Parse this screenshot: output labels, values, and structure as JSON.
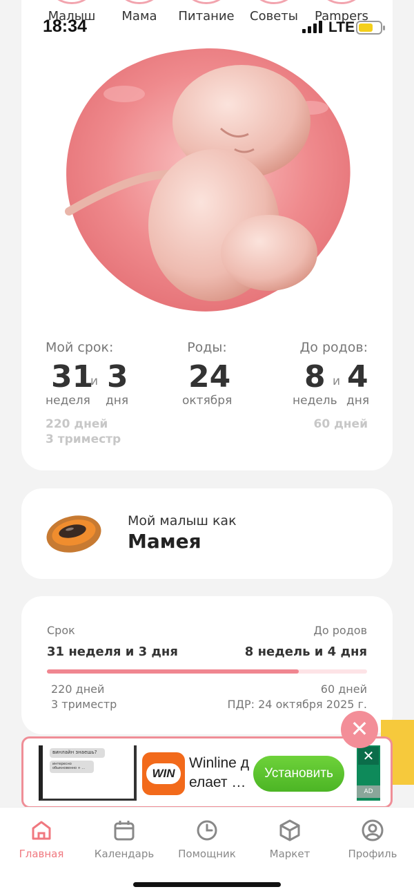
{
  "status_bar": {
    "time": "18:34",
    "network": "LTE"
  },
  "top_tabs": [
    "Малыш",
    "Мама",
    "Питание",
    "Советы",
    "Pampers"
  ],
  "summary": {
    "my_term_label": "Мой срок:",
    "weeks": "31",
    "and": "и",
    "days": "3",
    "weeks_unit": "неделя",
    "days_unit": "дня",
    "days_total": "220 дней",
    "trimester": "3 триместр",
    "birth_label": "Роды:",
    "birth_day": "24",
    "birth_month": "октября",
    "until_label": "До родов:",
    "until_weeks": "8",
    "until_days": "4",
    "until_weeks_unit": "недель",
    "until_days_unit": "дня",
    "until_days_total": "60 дней"
  },
  "baby": {
    "subtitle": "Мой малыш как",
    "fruit": "Мамея"
  },
  "progress": {
    "term_label": "Срок",
    "term_value": "31 неделя и 3 дня",
    "until_label": "До родов",
    "until_value": "8 недель и 4 дня",
    "fraction": 0.786,
    "days": "220 дней",
    "trimester": "3 триместр",
    "days_left": "60 дней",
    "due_date": "ПДР: 24 октября 2025 г."
  },
  "ad": {
    "thumb_line1": "винлайн знаешь?",
    "thumb_line2": "интересно обыкновенно + ...",
    "logo_text": "WIN",
    "text": "Winline д елает …",
    "install_label": "Установить",
    "tag": "AD"
  },
  "nav": [
    {
      "label": "Главная",
      "icon": "home-icon"
    },
    {
      "label": "Календарь",
      "icon": "calendar-icon"
    },
    {
      "label": "Помощник",
      "icon": "clock-icon"
    },
    {
      "label": "Маркет",
      "icon": "box-icon"
    },
    {
      "label": "Профиль",
      "icon": "profile-icon"
    }
  ],
  "colors": {
    "accent": "#f0787f",
    "bar": "#f08690",
    "bar_track": "#fde3e6",
    "install": "#57be2c",
    "win_logo": "#f26a1b"
  }
}
